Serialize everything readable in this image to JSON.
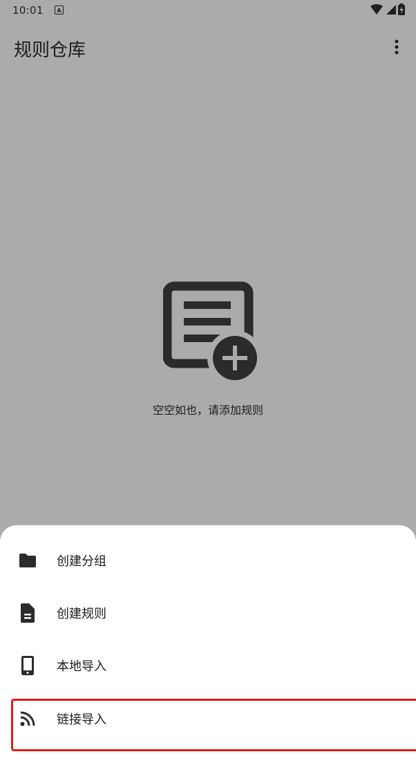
{
  "status_bar": {
    "time": "10:01",
    "notification_icon": "A"
  },
  "toolbar": {
    "title": "规则仓库",
    "more_icon": "more-vertical-icon"
  },
  "empty_state": {
    "icon": "note-add-icon",
    "text": "空空如也，请添加规则"
  },
  "bottom_sheet": {
    "items": [
      {
        "label": "创建分组",
        "icon": "folder-icon"
      },
      {
        "label": "创建规则",
        "icon": "document-icon"
      },
      {
        "label": "本地导入",
        "icon": "phone-icon"
      },
      {
        "label": "链接导入",
        "icon": "rss-icon"
      }
    ]
  },
  "colors": {
    "scrim": "#ababab",
    "sheet_background": "#ffffff",
    "highlight": "#e01b1b",
    "icon": "#2b2b2b"
  }
}
